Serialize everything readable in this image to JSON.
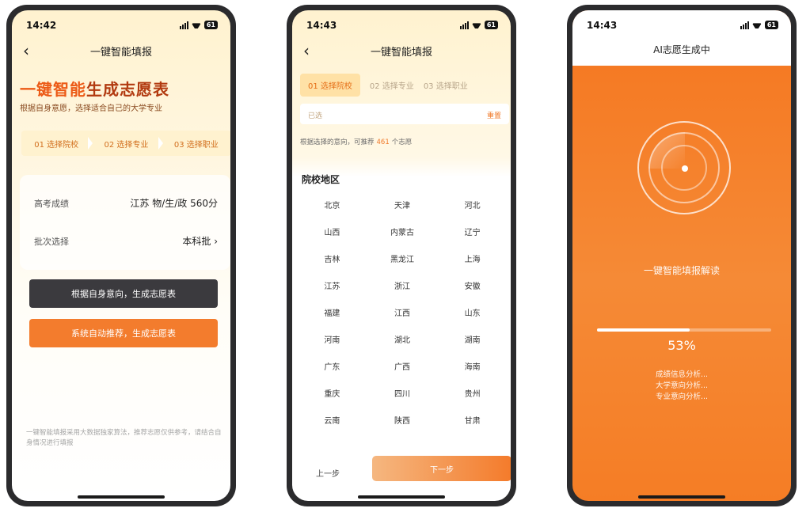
{
  "phone1": {
    "time": "14:42",
    "battery": "61",
    "nav_title": "一键智能填报",
    "hero": {
      "part1": "一键智能",
      "part2": "生成志愿表",
      "subtitle": "根据自身意愿，选择适合自己的大学专业"
    },
    "steps": [
      "01 选择院校",
      "02 选择专业",
      "03 选择职业"
    ],
    "score_label": "高考成绩",
    "score_value": "江苏 物/生/政 560分",
    "batch_label": "批次选择",
    "batch_value": "本科批",
    "btn_self": "根据自身意向，生成志愿表",
    "btn_auto": "系统自动推荐，生成志愿表",
    "disclaimer": "一键智能填报采用大数据独家算法，推荐志愿仅供参考，请结合自身情况进行填报"
  },
  "phone2": {
    "time": "14:43",
    "battery": "61",
    "nav_title": "一键智能填报",
    "steps": [
      "01 选择院校",
      "02 选择专业",
      "03 选择职业"
    ],
    "selected_label": "已选",
    "reset_label": "重置",
    "hint_prefix": "根据选择的意向，可推荐",
    "hint_count": "461",
    "hint_suffix": "个志愿",
    "region_title": "院校地区",
    "regions": [
      "北京",
      "天津",
      "河北",
      "山西",
      "内蒙古",
      "辽宁",
      "吉林",
      "黑龙江",
      "上海",
      "江苏",
      "浙江",
      "安徽",
      "福建",
      "江西",
      "山东",
      "河南",
      "湖北",
      "湖南",
      "广东",
      "广西",
      "海南",
      "重庆",
      "四川",
      "贵州",
      "云南",
      "陕西",
      "甘肃"
    ],
    "prev_label": "上一步",
    "next_label": "下一步"
  },
  "phone3": {
    "time": "14:43",
    "battery": "61",
    "title": "AI志愿生成中",
    "caption": "一键智能填报解读",
    "progress": 53,
    "progress_text": "53%",
    "analysis": [
      "成绩信息分析...",
      "大学意向分析...",
      "专业意向分析..."
    ]
  }
}
